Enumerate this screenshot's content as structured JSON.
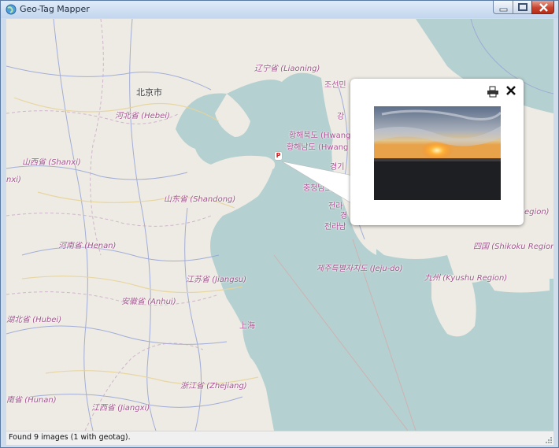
{
  "window": {
    "title": "Geo-Tag Mapper"
  },
  "controls": {
    "minimize": "minimize",
    "maximize": "maximize",
    "close": "close"
  },
  "map": {
    "labels": {
      "beijing": "北京市",
      "hebei": "河北省 (Hebei)",
      "liaoning": "辽宁省 (Liaoning)",
      "shanxi": "山西省 (Shanxi)",
      "shanxi_left": "nxi)",
      "shandong": "山东省 (Shandong)",
      "henan": "河南省 (Henan)",
      "jiangsu": "江苏省 (Jiangsu)",
      "anhui": "安徽省 (Anhui)",
      "hubei": "湖北省 (Hubei)",
      "shanghai": "上海",
      "zhejiang": "浙江省 (Zhejiang)",
      "hunan": "南省 (Hunan)",
      "jiangxi": "江西省 (Jiangxi)",
      "hwanghae_n": "황해북도 (Hwang",
      "hwanghae_s": "황해남도 (Hwang",
      "chosun": "조선민",
      "kang": "강",
      "gyeonggi": "경기",
      "chungnam": "충청남도 (",
      "jeolla_n": "전라",
      "jeolla_n2": "경",
      "jeolla_s": "전라남",
      "jeju": "제주특별자치도 (Jeju-do)",
      "kyushu": "九州 (Kyushu Region)",
      "shikoku": "四国 (Shikoku Region)",
      "region": "Region)"
    },
    "marker_label": "P"
  },
  "popup": {
    "print": "print-icon",
    "close": "close-icon",
    "photo": "sunset photo"
  },
  "status": {
    "text": "Found 9 images (1 with geotag)."
  }
}
